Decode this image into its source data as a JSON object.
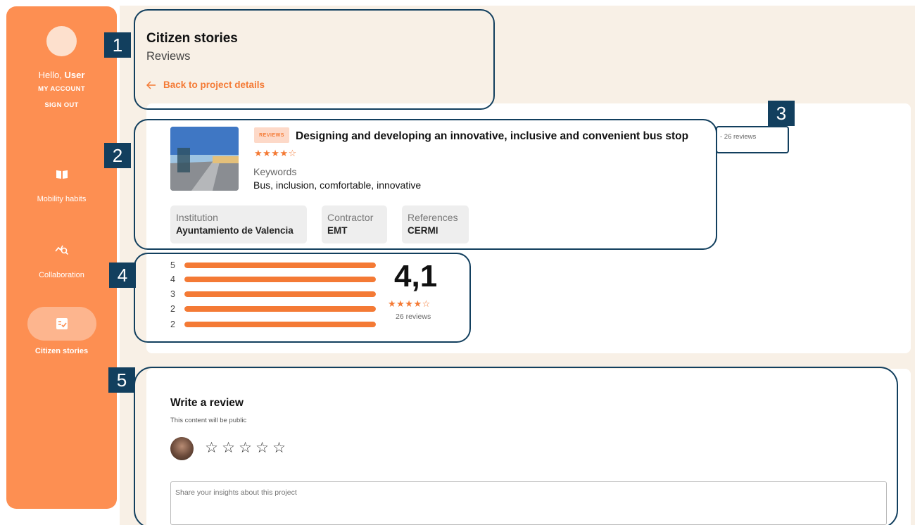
{
  "sidebar": {
    "greeting": "Hello,",
    "username": "User",
    "my_account": "MY ACCOUNT",
    "sign_out": "SIGN OUT",
    "nav": [
      {
        "label": "Mobility habits",
        "icon": "book-icon"
      },
      {
        "label": "Collaboration",
        "icon": "chart-search-icon"
      },
      {
        "label": "Citizen stories",
        "icon": "checklist-icon",
        "active": true
      }
    ],
    "accent_color": "#fd8f52"
  },
  "header": {
    "title": "Citizen stories",
    "subtitle": "Reviews",
    "back_link": "Back to project details"
  },
  "project": {
    "badge": "REVIEWS",
    "title": "Designing and developing an innovative, inclusive and convenient bus stop",
    "reviews_count": "- 26 reviews",
    "stars": "★★★★☆",
    "keywords_label": "Keywords",
    "keywords": "Bus, inclusion, comfortable, innovative",
    "meta": [
      {
        "label": "Institution",
        "value": "Ayuntamiento de Valencia"
      },
      {
        "label": "Contractor",
        "value": "EMT"
      },
      {
        "label": "References",
        "value": "CERMI"
      }
    ]
  },
  "rating": {
    "distribution": [
      {
        "label": "5",
        "fraction": 1.0
      },
      {
        "label": "4",
        "fraction": 1.0
      },
      {
        "label": "3",
        "fraction": 1.0
      },
      {
        "label": "2",
        "fraction": 1.0
      },
      {
        "label": "2",
        "fraction": 1.0
      }
    ],
    "score": "4,1",
    "stars": "★★★★☆",
    "reviews": "26 reviews"
  },
  "write_review": {
    "title": "Write a review",
    "subtitle": "This content will be public",
    "star_input": [
      "☆",
      "☆",
      "☆",
      "☆",
      "☆"
    ],
    "placeholder": "Share your insights about this project"
  },
  "annotations": [
    "1",
    "2",
    "3",
    "4",
    "5"
  ],
  "colors": {
    "accent": "#f47a35",
    "annotation": "#123f5e",
    "background": "#f8f0e6"
  }
}
